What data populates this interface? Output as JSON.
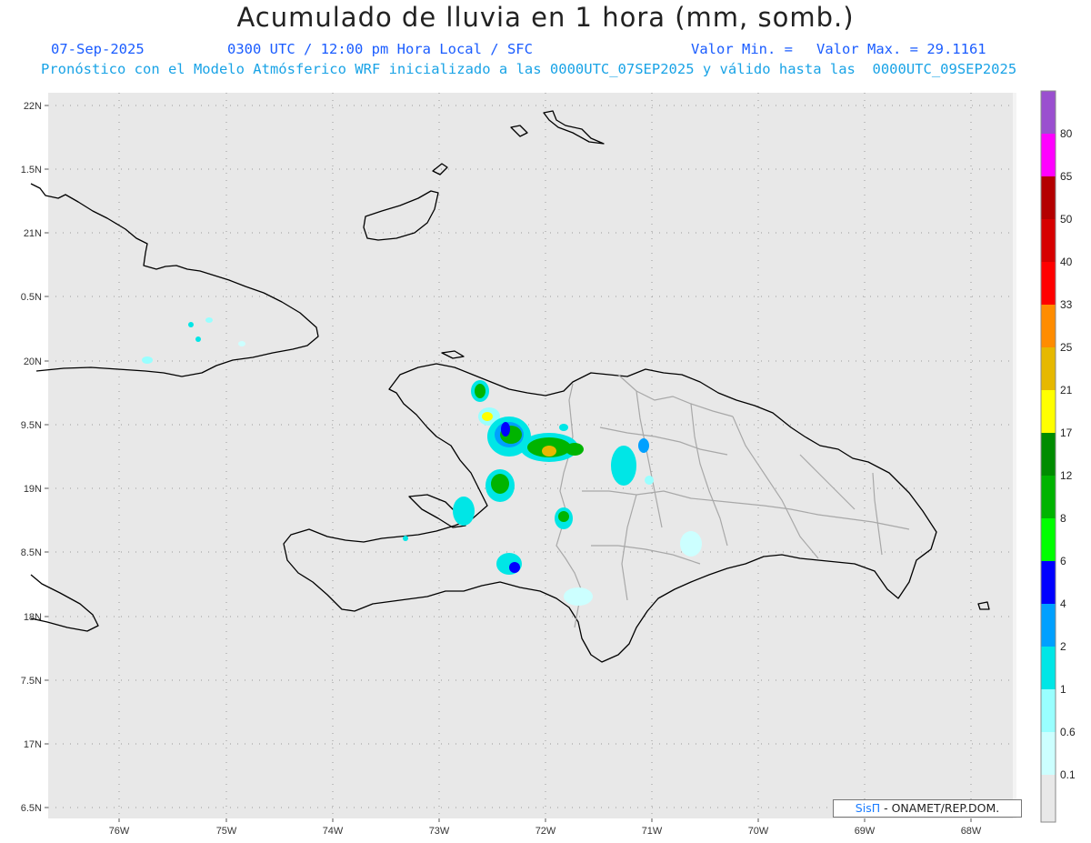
{
  "header": {
    "title": "Acumulado de lluvia en 1 hora (mm, somb.)",
    "date": "07-Sep-2025",
    "time_info": "0300 UTC / 12:00 pm Hora Local / SFC",
    "min_label": "Valor Min. =",
    "max_label": "Valor Max. = 29.1161",
    "model_info": "Pronóstico con el Modelo Atmósferico WRF inicializado a las 0000UTC_07SEP2025 y válido hasta las  0000UTC_09SEP2025"
  },
  "credit": {
    "brand": "SisΠ",
    "org": " - ONAMET/REP.DOM."
  },
  "axes": {
    "lat_labels": [
      "22N",
      "1.5N",
      "21N",
      "0.5N",
      "20N",
      "9.5N",
      "19N",
      "8.5N",
      "18N",
      "7.5N",
      "17N",
      "6.5N"
    ],
    "lon_labels": [
      "76W",
      "75W",
      "74W",
      "73W",
      "72W",
      "71W",
      "70W",
      "69W",
      "68W"
    ],
    "lat_range": [
      16.5,
      22
    ],
    "lon_range": [
      -76.7,
      -67.5
    ],
    "grid": "dotted"
  },
  "colorbar": {
    "labels": [
      "80",
      "65",
      "50",
      "40",
      "33",
      "25",
      "21",
      "17",
      "12",
      "8",
      "6",
      "4",
      "2",
      "1",
      "0.6",
      "0.1"
    ],
    "colors": [
      "#9a4fcf",
      "#ff00ff",
      "#b40000",
      "#d60000",
      "#ff0000",
      "#ff8c00",
      "#e6b800",
      "#ffff00",
      "#008c00",
      "#00b400",
      "#00ff00",
      "#0000ff",
      "#00a0ff",
      "#00e6e6",
      "#99ffff",
      "#ccffff",
      "#e8e8e8"
    ]
  },
  "colors": {
    "land_bg": "#e8e8e8",
    "coast": "#000000",
    "borders": "#aaaaaa"
  }
}
